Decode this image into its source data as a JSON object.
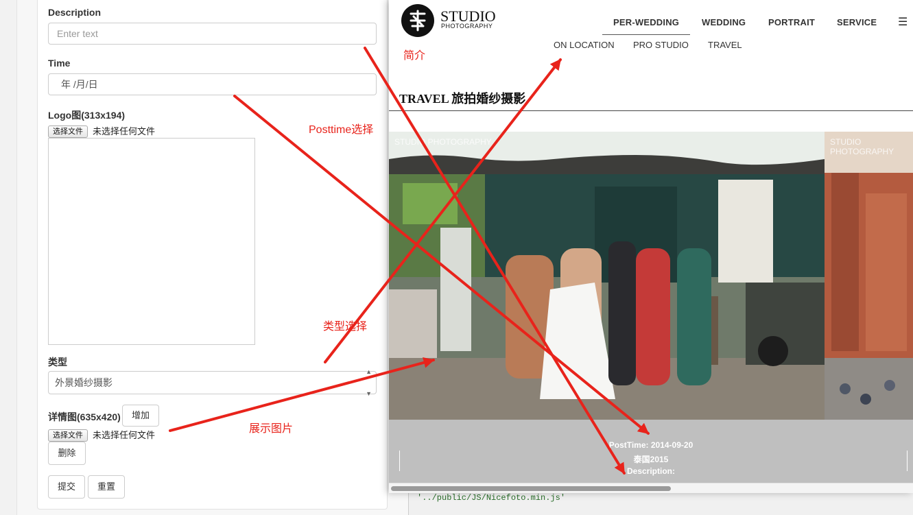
{
  "form": {
    "description": {
      "label": "Description",
      "placeholder": "Enter text"
    },
    "time": {
      "label": "Time",
      "value": "年 /月/日"
    },
    "logo": {
      "label": "Logo图(313x194)",
      "choose_file": "选择文件",
      "no_file": "未选择任何文件"
    },
    "type": {
      "label": "类型",
      "selected": "外景婚纱摄影"
    },
    "detail": {
      "label": "详情图(635x420)",
      "add": "增加",
      "choose_file": "选择文件",
      "no_file": "未选择任何文件",
      "delete": "删除"
    },
    "submit": "提交",
    "reset": "重置"
  },
  "site": {
    "logo_title": "STUDIO",
    "logo_subtitle": "PHOTOGRAPHY",
    "nav": [
      "PER-WEDDING",
      "WEDDING",
      "PORTRAIT",
      "SERVICE"
    ],
    "subnav": [
      "ON LOCATION",
      "PRO STUDIO",
      "TRAVEL"
    ],
    "section_title": "TRAVEL 旅拍婚纱摄影",
    "watermark": "STUDIO PHOTOGRAPHY",
    "caption": {
      "posttime": "PostTime: 2014-09-20",
      "title": "泰国2015",
      "description": "Description:"
    }
  },
  "editor": {
    "code_line": "'../public/JS/Nicefoto.min.js'"
  },
  "annotations": {
    "intro": "简介",
    "posttime_select": "Posttime选择",
    "type_select": "类型选择",
    "show_image": "展示图片"
  },
  "colors": {
    "annotation": "#e8231b",
    "caption_bar": "#bfbfbf"
  }
}
